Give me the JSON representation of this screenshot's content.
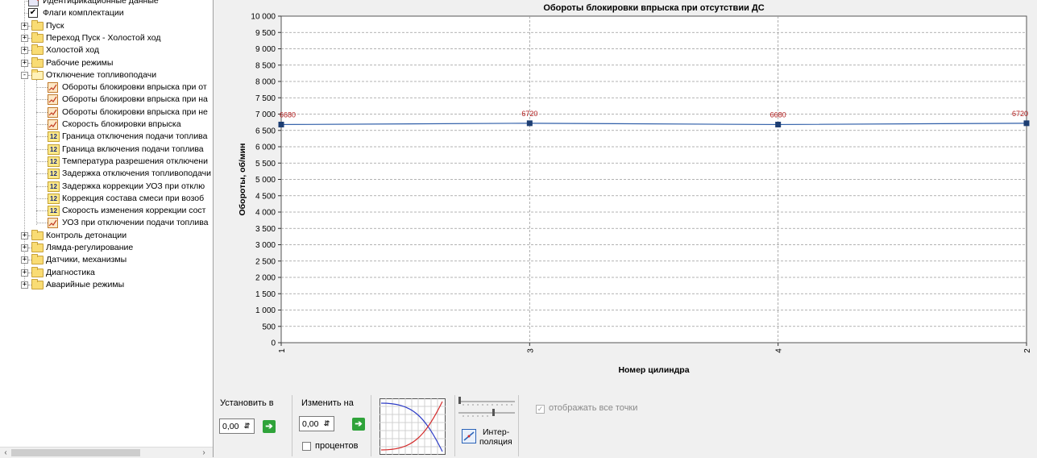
{
  "tree": {
    "items": [
      {
        "label": "Идентификационные данные",
        "icon": "document-icon",
        "indent": 1
      },
      {
        "label": "Флаги комплектации",
        "icon": "checkbox-icon",
        "indent": 1
      },
      {
        "label": "Пуск",
        "icon": "folder-icon",
        "indent": 0,
        "expander": "+"
      },
      {
        "label": "Переход Пуск - Холостой ход",
        "icon": "folder-icon",
        "indent": 0,
        "expander": "+"
      },
      {
        "label": "Холостой ход",
        "icon": "folder-icon",
        "indent": 0,
        "expander": "+"
      },
      {
        "label": "Рабочие режимы",
        "icon": "folder-icon",
        "indent": 0,
        "expander": "+"
      },
      {
        "label": "Отключение топливоподачи",
        "icon": "folder-open-icon",
        "indent": 0,
        "expander": "-"
      },
      {
        "label": "Обороты блокировки впрыска при от",
        "icon": "chart-icon",
        "indent": 1
      },
      {
        "label": "Обороты блокировки впрыска при на",
        "icon": "chart-icon",
        "indent": 1
      },
      {
        "label": "Обороты блокировки впрыска при не",
        "icon": "chart-icon",
        "indent": 1
      },
      {
        "label": "Скорость блокировки впрыска",
        "icon": "chart-icon",
        "indent": 1
      },
      {
        "label": "Граница отключения подачи топлива",
        "icon": "number-icon",
        "indent": 1
      },
      {
        "label": "Граница включения подачи топлива",
        "icon": "number-icon",
        "indent": 1
      },
      {
        "label": "Температура разрешения отключени",
        "icon": "number-icon",
        "indent": 1
      },
      {
        "label": "Задержка отключения топливоподачи",
        "icon": "number-icon",
        "indent": 1
      },
      {
        "label": "Задержка коррекции УОЗ при отклю",
        "icon": "number-icon",
        "indent": 1
      },
      {
        "label": "Коррекция состава смеси при возоб",
        "icon": "number-icon",
        "indent": 1
      },
      {
        "label": "Скорость изменения коррекции сост",
        "icon": "number-icon",
        "indent": 1
      },
      {
        "label": "УОЗ при отключении подачи топлива",
        "icon": "chart-icon",
        "indent": 1
      },
      {
        "label": "Контроль детонации",
        "icon": "folder-icon",
        "indent": 0,
        "expander": "+"
      },
      {
        "label": "Лямда-регулирование",
        "icon": "folder-icon",
        "indent": 0,
        "expander": "+"
      },
      {
        "label": "Датчики, механизмы",
        "icon": "folder-icon",
        "indent": 0,
        "expander": "+"
      },
      {
        "label": "Диагностика",
        "icon": "folder-icon",
        "indent": 0,
        "expander": "+"
      },
      {
        "label": "Аварийные режимы",
        "icon": "folder-icon",
        "indent": 0,
        "expander": "+"
      }
    ],
    "number_icon_text": "12",
    "scroll_left": "‹",
    "scroll_right": "›"
  },
  "chart_data": {
    "type": "line",
    "title": "Обороты блокировки впрыска при отсутствии ДС",
    "xlabel": "Номер цилиндра",
    "ylabel": "Обороты, об/мин",
    "categories": [
      "1",
      "3",
      "4",
      "2"
    ],
    "series": [
      {
        "values": [
          6680,
          6720,
          6680,
          6720
        ]
      }
    ],
    "point_labels": [
      "6680",
      "6720",
      "6680",
      "6720"
    ],
    "ylim": [
      0,
      10000
    ],
    "y_ticks": [
      "0",
      "500",
      "1 000",
      "1 500",
      "2 000",
      "2 500",
      "3 000",
      "3 500",
      "4 000",
      "4 500",
      "5 000",
      "5 500",
      "6 000",
      "6 500",
      "7 000",
      "7 500",
      "8 000",
      "8 500",
      "9 000",
      "9 500",
      "10 000"
    ],
    "grid": true,
    "colors": {
      "line": "#2f5ea8",
      "marker": "#1d3e73",
      "labels": "#b01818"
    }
  },
  "toolbar": {
    "set_to_label": "Установить в",
    "set_to_value": "0,00",
    "change_by_label": "Изменить на",
    "change_by_value": "0,00",
    "percent_label": "процентов",
    "interp_label_1": "Интер-",
    "interp_label_2": "поляция",
    "show_all_points_label": "отображать все точки",
    "show_all_points_checked": true,
    "go_glyph": "➔",
    "spin_glyph": "⇵"
  }
}
